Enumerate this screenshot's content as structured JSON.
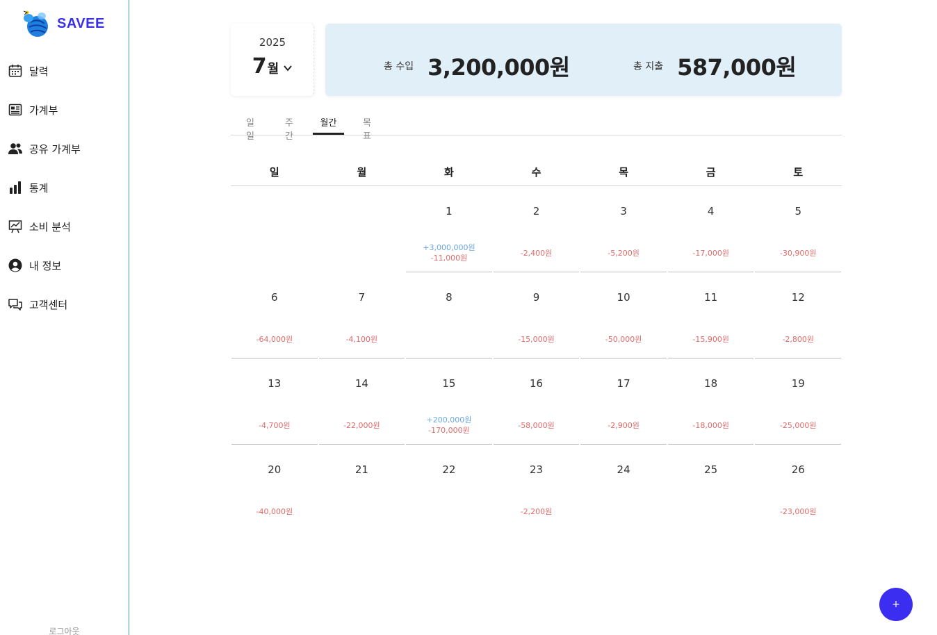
{
  "brand": {
    "name": "SAVEE",
    "color": "#3b30e6"
  },
  "sidebar": {
    "items": [
      {
        "label": "달력",
        "icon": "calendar-icon"
      },
      {
        "label": "가계부",
        "icon": "ledger-icon"
      },
      {
        "label": "공유 가계부",
        "icon": "users-icon"
      },
      {
        "label": "통계",
        "icon": "bar-chart-icon"
      },
      {
        "label": "소비 분석",
        "icon": "trend-chart-icon"
      },
      {
        "label": "내 정보",
        "icon": "user-circle-icon"
      },
      {
        "label": "고객센터",
        "icon": "chat-bubbles-icon"
      }
    ],
    "logout": "로그아웃"
  },
  "header": {
    "year": "2025",
    "month_num": "7",
    "month_unit": "월",
    "income_label": "총 수입",
    "income_value": "3,200,000원",
    "expense_label": "총 지출",
    "expense_value": "587,000원"
  },
  "tabs": [
    {
      "label": "일일",
      "active": false
    },
    {
      "label": "주간",
      "active": false
    },
    {
      "label": "월간",
      "active": true
    },
    {
      "label": "목표",
      "active": false
    }
  ],
  "calendar": {
    "weekdays": [
      "일",
      "월",
      "화",
      "수",
      "목",
      "금",
      "토"
    ],
    "weeks": [
      [
        null,
        null,
        {
          "day": "1",
          "income": "+3,000,000원",
          "expense": "-11,000원"
        },
        {
          "day": "2",
          "expense": "-2,400원"
        },
        {
          "day": "3",
          "expense": "-5,200원"
        },
        {
          "day": "4",
          "expense": "-17,000원"
        },
        {
          "day": "5",
          "expense": "-30,900원"
        }
      ],
      [
        {
          "day": "6",
          "expense": "-64,000원"
        },
        {
          "day": "7",
          "expense": "-4,100원"
        },
        {
          "day": "8"
        },
        {
          "day": "9",
          "expense": "-15,000원"
        },
        {
          "day": "10",
          "expense": "-50,000원"
        },
        {
          "day": "11",
          "expense": "-15,900원"
        },
        {
          "day": "12",
          "expense": "-2,800원"
        }
      ],
      [
        {
          "day": "13",
          "expense": "-4,700원"
        },
        {
          "day": "14",
          "expense": "-22,000원"
        },
        {
          "day": "15",
          "income": "+200,000원",
          "expense": "-170,000원"
        },
        {
          "day": "16",
          "expense": "-58,000원"
        },
        {
          "day": "17",
          "expense": "-2,900원"
        },
        {
          "day": "18",
          "expense": "-18,000원"
        },
        {
          "day": "19",
          "expense": "-25,000원"
        }
      ],
      [
        {
          "day": "20",
          "expense": "-40,000원"
        },
        {
          "day": "21"
        },
        {
          "day": "22"
        },
        {
          "day": "23",
          "expense": "-2,200원"
        },
        {
          "day": "24"
        },
        {
          "day": "25"
        },
        {
          "day": "26",
          "expense": "-23,000원"
        }
      ]
    ]
  },
  "fab": {
    "label": "+",
    "color": "#3b2ef0"
  },
  "colors": {
    "income": "#6aa6e0",
    "expense": "#e06a6a",
    "summary_bg": "#e1eff8",
    "sidebar_border": "#4a9aa0"
  }
}
